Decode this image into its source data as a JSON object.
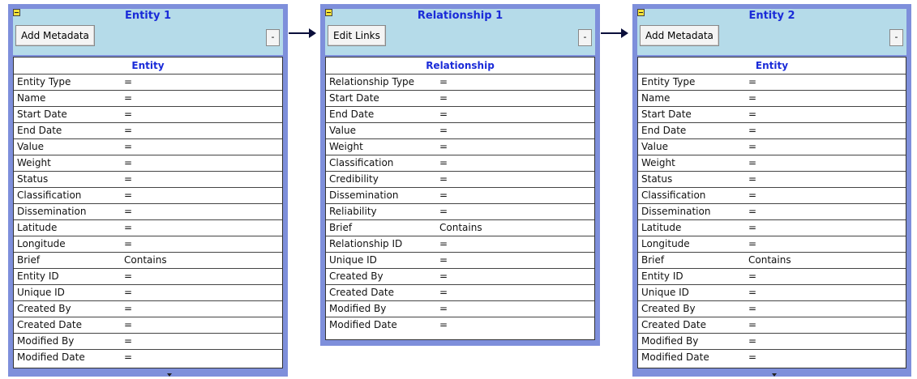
{
  "panels": [
    {
      "title": "Entity 1",
      "button_label": "Add Metadata",
      "min_label": "-",
      "table_title": "Entity",
      "rows": [
        {
          "label": "Entity Type",
          "value": "="
        },
        {
          "label": "Name",
          "value": "="
        },
        {
          "label": "Start Date",
          "value": "="
        },
        {
          "label": "End Date",
          "value": "="
        },
        {
          "label": "Value",
          "value": "="
        },
        {
          "label": "Weight",
          "value": "="
        },
        {
          "label": "Status",
          "value": "="
        },
        {
          "label": "Classification",
          "value": "="
        },
        {
          "label": "Dissemination",
          "value": "="
        },
        {
          "label": "Latitude",
          "value": "="
        },
        {
          "label": "Longitude",
          "value": "="
        },
        {
          "label": "Brief",
          "value": "Contains"
        },
        {
          "label": "Entity ID",
          "value": "="
        },
        {
          "label": "Unique ID",
          "value": "="
        },
        {
          "label": "Created By",
          "value": "="
        },
        {
          "label": "Created Date",
          "value": "="
        },
        {
          "label": "Modified By",
          "value": "="
        },
        {
          "label": "Modified Date",
          "value": "="
        }
      ]
    },
    {
      "title": "Relationship 1",
      "button_label": "Edit Links",
      "min_label": "-",
      "table_title": "Relationship",
      "rows": [
        {
          "label": "Relationship Type",
          "value": "="
        },
        {
          "label": "Start Date",
          "value": "="
        },
        {
          "label": "End Date",
          "value": "="
        },
        {
          "label": "Value",
          "value": "="
        },
        {
          "label": "Weight",
          "value": "="
        },
        {
          "label": "Classification",
          "value": "="
        },
        {
          "label": "Credibility",
          "value": "="
        },
        {
          "label": "Dissemination",
          "value": "="
        },
        {
          "label": "Reliability",
          "value": "="
        },
        {
          "label": "Brief",
          "value": "Contains"
        },
        {
          "label": "Relationship ID",
          "value": "="
        },
        {
          "label": "Unique ID",
          "value": "="
        },
        {
          "label": "Created By",
          "value": "="
        },
        {
          "label": "Created Date",
          "value": "="
        },
        {
          "label": "Modified By",
          "value": "="
        },
        {
          "label": "Modified Date",
          "value": "="
        }
      ]
    },
    {
      "title": "Entity 2",
      "button_label": "Add Metadata",
      "min_label": "-",
      "table_title": "Entity",
      "rows": [
        {
          "label": "Entity Type",
          "value": "="
        },
        {
          "label": "Name",
          "value": "="
        },
        {
          "label": "Start Date",
          "value": "="
        },
        {
          "label": "End Date",
          "value": "="
        },
        {
          "label": "Value",
          "value": "="
        },
        {
          "label": "Weight",
          "value": "="
        },
        {
          "label": "Status",
          "value": "="
        },
        {
          "label": "Classification",
          "value": "="
        },
        {
          "label": "Dissemination",
          "value": "="
        },
        {
          "label": "Latitude",
          "value": "="
        },
        {
          "label": "Longitude",
          "value": "="
        },
        {
          "label": "Brief",
          "value": "Contains"
        },
        {
          "label": "Entity ID",
          "value": "="
        },
        {
          "label": "Unique ID",
          "value": "="
        },
        {
          "label": "Created By",
          "value": "="
        },
        {
          "label": "Created Date",
          "value": "="
        },
        {
          "label": "Modified By",
          "value": "="
        },
        {
          "label": "Modified Date",
          "value": "="
        }
      ]
    }
  ],
  "colors": {
    "panel_border": "#7e8fdb",
    "header_bg": "#b5dbe9",
    "title_text": "#1a2bd8",
    "arrow": "#0a0e3a"
  }
}
